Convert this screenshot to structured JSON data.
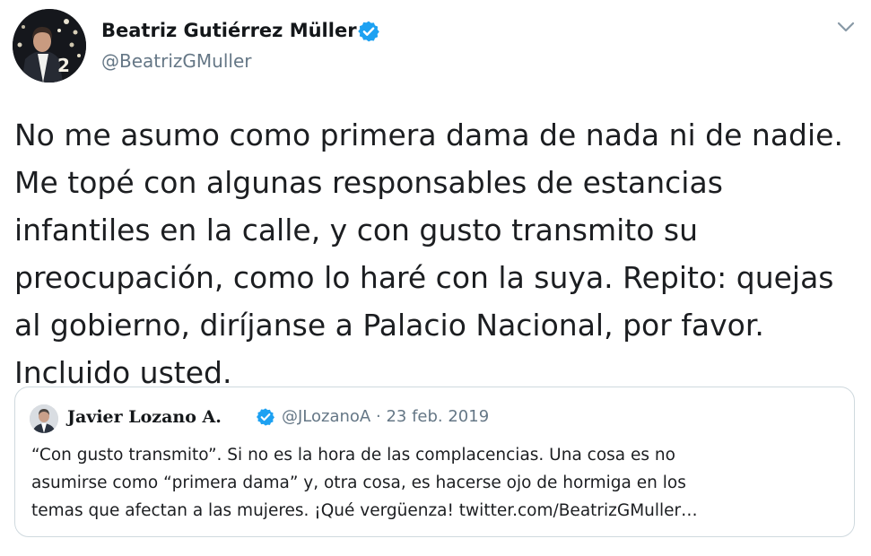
{
  "tweet": {
    "author_name": "Beatriz Gutiérrez Müller",
    "handle": "@BeatrizGMuller",
    "verified_icon": "verified-badge-icon",
    "menu_icon": "chevron-down-icon",
    "accent_color": "#1da1f2",
    "text_lines": [
      "No me asumo como primera dama de nada ni de nadie.",
      "Me topé con algunas responsables de estancias",
      "infantiles en la calle, y con gusto transmito su",
      "preocupación, como lo haré con la suya. Repito: quejas",
      "al gobierno, diríjanse a Palacio Nacional, por favor.",
      "Incluido usted."
    ],
    "avatar_overlay_text": "2"
  },
  "quoted": {
    "author_name": "Javier Lozano A.",
    "handle": "@JLozanoA",
    "separator": "·",
    "date": "23 feb. 2019",
    "text_lines": [
      "“Con gusto transmito”. Si no es la hora de las complacencias. Una cosa es no",
      "asumirse como “primera dama” y, otra cosa, es hacerse ojo de hormiga en los",
      "temas que afectan a las mujeres. ¡Qué vergüenza! twitter.com/BeatrizGMuller…"
    ]
  }
}
